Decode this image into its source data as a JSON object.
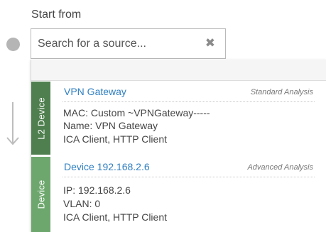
{
  "start": {
    "label": "Start from"
  },
  "search": {
    "placeholder": "Search for a source...",
    "clear_glyph": "✖"
  },
  "results": [
    {
      "tag": "L2 Device",
      "title": "VPN Gateway",
      "badge": "Standard Analysis",
      "details": [
        "MAC: Custom ~VPNGateway-----",
        "Name: VPN Gateway",
        "ICA Client, HTTP Client"
      ],
      "tag_color": "#4f7f4f"
    },
    {
      "tag": "Device",
      "title": "Device 192.168.2.6",
      "badge": "Advanced Analysis",
      "details": [
        "IP: 192.168.2.6",
        "VLAN: 0",
        "ICA Client, HTTP Client"
      ],
      "tag_color": "#6ea76e"
    }
  ],
  "colors": {
    "link": "#2f7fc1",
    "step_dot": "#b5b5b5"
  },
  "icons": {
    "clear": "close-icon",
    "step": "step-dot-icon",
    "flow": "arrow-down-icon"
  }
}
